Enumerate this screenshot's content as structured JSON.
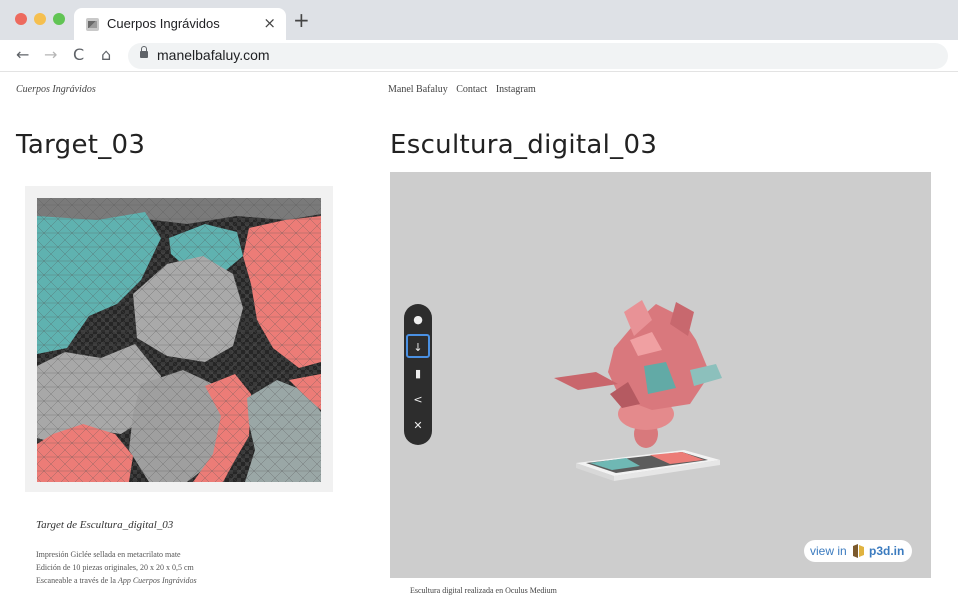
{
  "browser": {
    "tab_title": "Cuerpos Ingrávidos",
    "tab_close": "×",
    "new_tab": "+",
    "url": "manelbafaluy.com",
    "back": "←",
    "forward": "→",
    "reload": "C",
    "home": "⌂"
  },
  "site": {
    "name": "Cuerpos Ingrávidos",
    "nav": [
      "Manel Bafaluy",
      "Contact",
      "Instagram"
    ]
  },
  "left": {
    "heading": "Target_03",
    "caption_title": "Target de Escultura_digital_03",
    "caption_line1": "Impresión Giclée sellada en metacrilato mate",
    "caption_line2": "Edición de 10 piezas originales, 20 x 20  x 0,5 cm",
    "caption_line3_prefix": "Escaneable a través de la ",
    "caption_line3_app": "App Cuerpos Ingrávidos"
  },
  "right": {
    "heading": "Escultura_digital_03",
    "viewer_badge_prefix": "view in",
    "viewer_badge_brand": "p3d.in",
    "caption": "Escultura digital realizada en Oculus Medium",
    "tools": [
      "globe-icon",
      "arrow-down-icon",
      "mouse-icon",
      "share-icon",
      "fullscreen-icon"
    ]
  },
  "colors": {
    "teal": "#5fb2b0",
    "salmon": "#ec7c77",
    "grey": "#a8a8a8",
    "dark": "#2c2c2c",
    "link": "#3b7bbf"
  }
}
